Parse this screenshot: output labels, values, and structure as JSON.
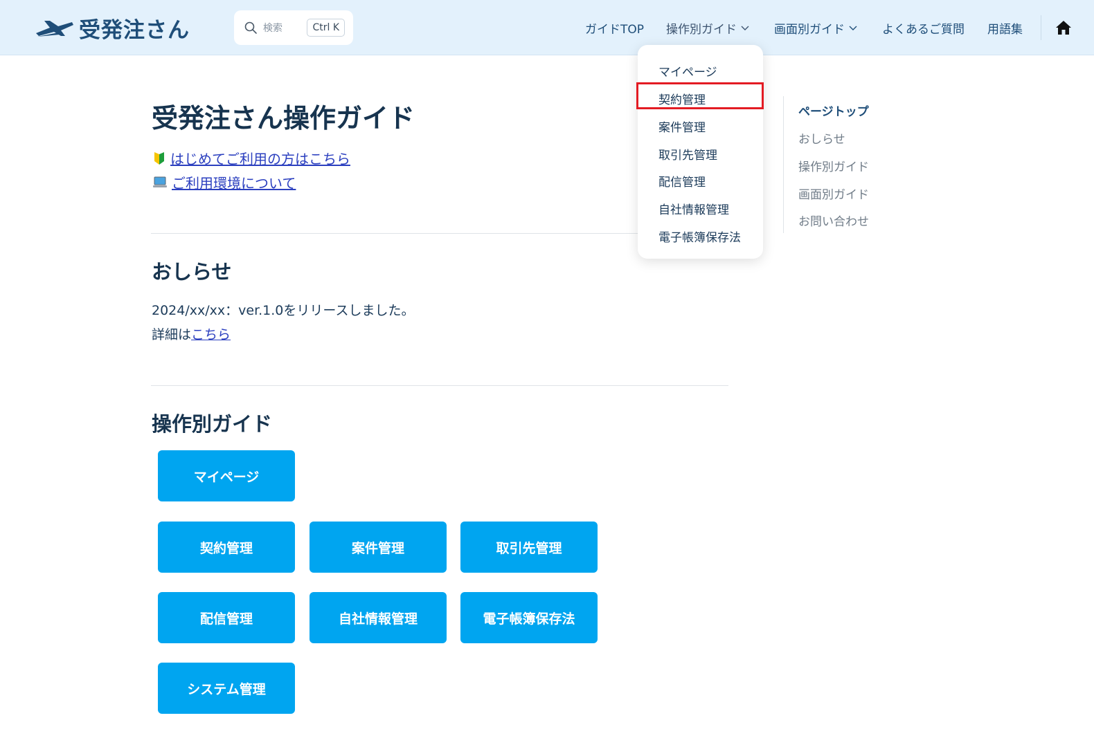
{
  "header": {
    "logo_text": "受発注さん",
    "search": {
      "placeholder": "検索",
      "shortcut": "Ctrl K"
    },
    "nav": {
      "guide_top": "ガイドTOP",
      "by_operation": "操作別ガイド",
      "by_screen": "画面別ガイド",
      "faq": "よくあるご質問",
      "glossary": "用語集"
    }
  },
  "dropdown": {
    "items": [
      "マイページ",
      "契約管理",
      "案件管理",
      "取引先管理",
      "配信管理",
      "自社情報管理",
      "電子帳簿保存法"
    ]
  },
  "main": {
    "title": "受発注さん操作ガイド",
    "links": {
      "beginner": "はじめてご利用の方はこちら",
      "environment": "ご利用環境について"
    },
    "news": {
      "heading": "おしらせ",
      "line1": "2024/xx/xx：ver.1.0をリリースしました。",
      "detail_prefix": "詳細は",
      "detail_link": "こちら"
    },
    "guide": {
      "heading": "操作別ガイド",
      "buttons": [
        "マイページ",
        "契約管理",
        "案件管理",
        "取引先管理",
        "配信管理",
        "自社情報管理",
        "電子帳簿保存法",
        "システム管理"
      ]
    }
  },
  "toc": {
    "items": [
      "ページトップ",
      "おしらせ",
      "操作別ガイド",
      "画面別ガイド",
      "お問い合わせ"
    ]
  },
  "colors": {
    "header_bg": "#e3f1fc",
    "button_bg": "#00a5f0",
    "highlight_border": "#e31b23",
    "link": "#2b3fbf"
  }
}
